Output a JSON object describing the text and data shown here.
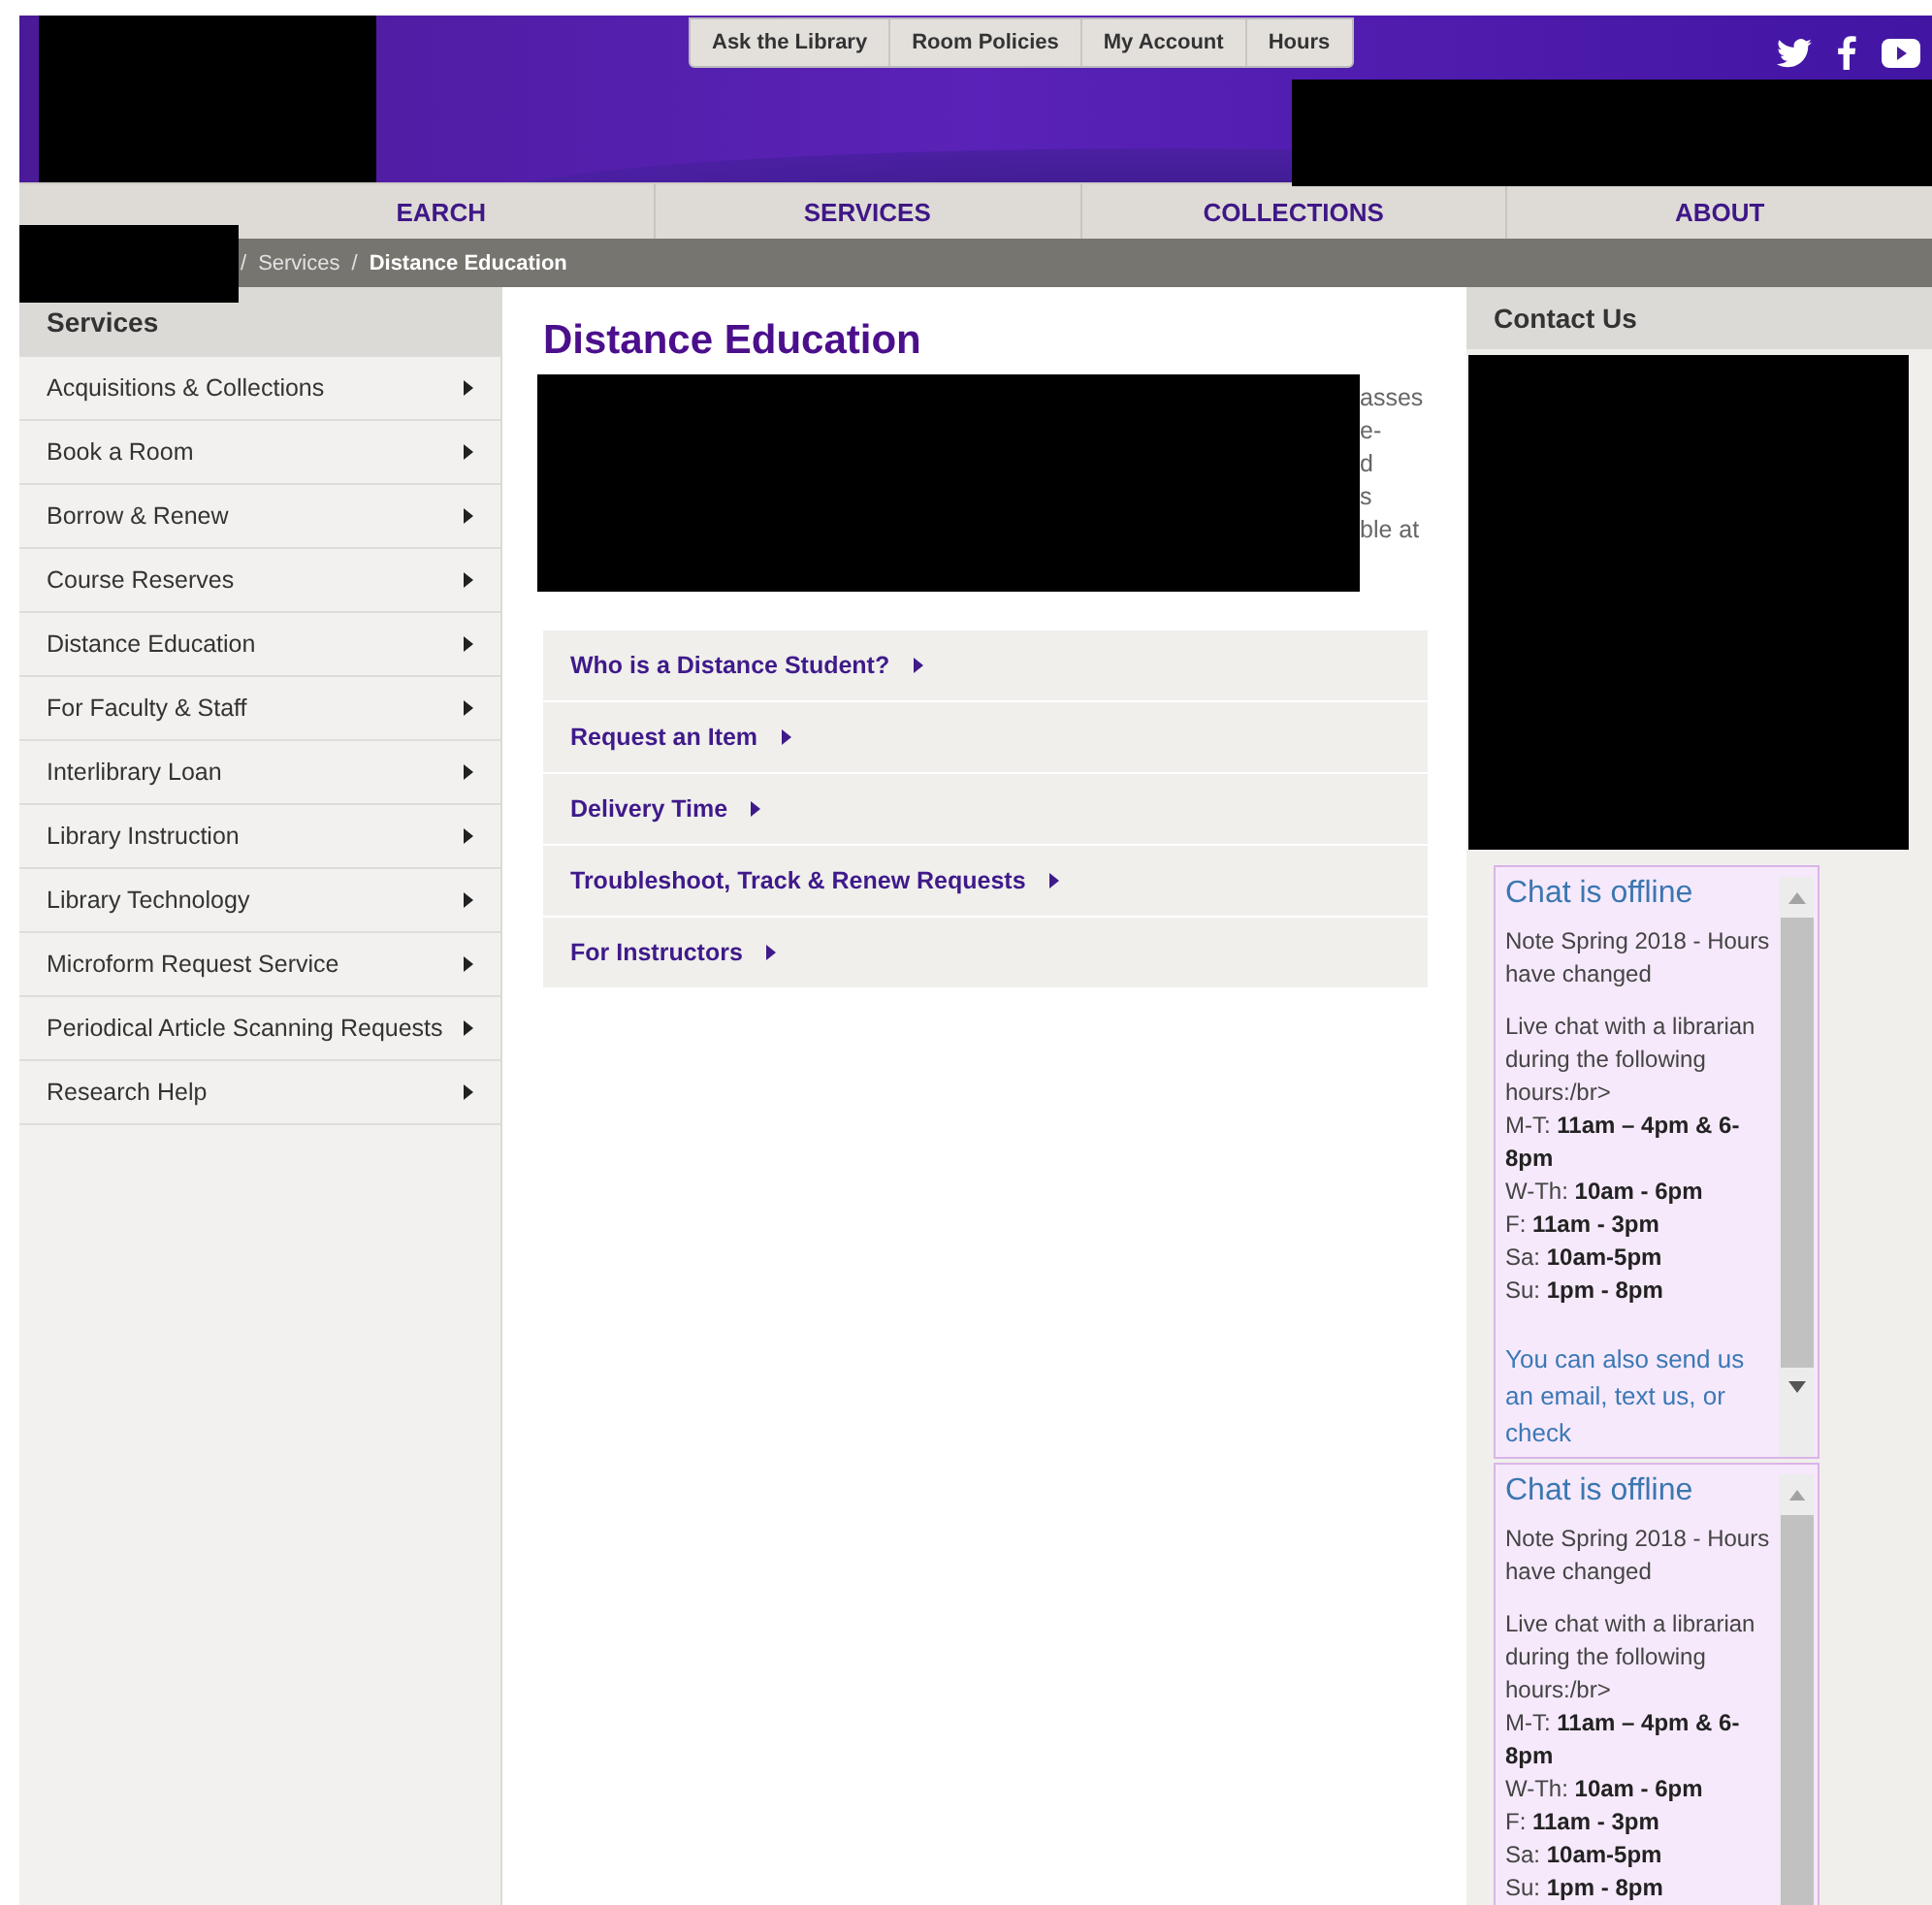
{
  "header": {
    "top_links": [
      {
        "label": "Ask the Library"
      },
      {
        "label": "Room Policies"
      },
      {
        "label": "My Account"
      },
      {
        "label": "Hours"
      }
    ],
    "social_icons": [
      {
        "kind": "twitter"
      },
      {
        "kind": "facebook"
      },
      {
        "kind": "youtube"
      }
    ]
  },
  "nav": [
    {
      "label": "EARCH"
    },
    {
      "label": "SERVICES"
    },
    {
      "label": "COLLECTIONS"
    },
    {
      "label": "ABOUT"
    }
  ],
  "breadcrumb": {
    "separator": "/",
    "items": [
      {
        "label": "Services",
        "current": false
      },
      {
        "label": "Distance Education",
        "current": true
      }
    ]
  },
  "sidebar": {
    "title": "Services",
    "items": [
      {
        "label": "Acquisitions & Collections"
      },
      {
        "label": "Book a Room"
      },
      {
        "label": "Borrow & Renew"
      },
      {
        "label": "Course Reserves"
      },
      {
        "label": "Distance Education"
      },
      {
        "label": "For Faculty & Staff"
      },
      {
        "label": "Interlibrary Loan"
      },
      {
        "label": "Library Instruction"
      },
      {
        "label": "Library Technology"
      },
      {
        "label": "Microform Request Service"
      },
      {
        "label": "Periodical Article Scanning Requests"
      },
      {
        "label": "Research Help"
      }
    ]
  },
  "main": {
    "title": "Distance Education",
    "intro_fragments": [
      "asses",
      "e-",
      "d",
      "s",
      "ble at"
    ],
    "sections": [
      {
        "label": "Who is a Distance Student?"
      },
      {
        "label": "Request an Item"
      },
      {
        "label": "Delivery Time"
      },
      {
        "label": "Troubleshoot, Track & Renew Requests"
      },
      {
        "label": "For Instructors"
      }
    ]
  },
  "contact": {
    "title": "Contact Us",
    "chat_widgets": [
      {
        "status": "Chat is offline",
        "note": "Note Spring 2018 - Hours have changed",
        "intro": "Live chat with a librarian during the following hours:/br>",
        "hours": [
          "M-T: **11am – 4pm & 6-8pm**",
          "W-Th: **10am - 6pm**",
          "F: **11am - 3pm**",
          "Sa: **10am-5pm**",
          "Su: **1pm - 8pm**"
        ],
        "link": "You can also send us an email, text us, or check"
      },
      {
        "status": "Chat is offline",
        "note": "Note Spring 2018 - Hours have changed",
        "intro": "Live chat with a librarian during the following hours:/br>",
        "hours": [
          "M-T: **11am – 4pm & 6-8pm**",
          "W-Th: **10am - 6pm**",
          "F: **11am - 3pm**",
          "Sa: **10am-5pm**",
          "Su: **1pm - 8pm**"
        ]
      }
    ]
  }
}
